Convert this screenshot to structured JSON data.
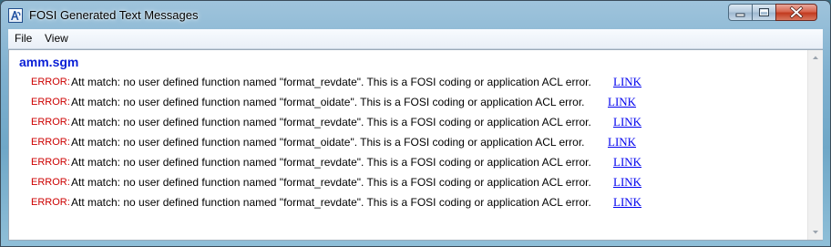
{
  "window": {
    "title": "FOSI Generated Text Messages",
    "accent_color": "#6fa7c7",
    "close_color": "#c23a1f"
  },
  "menu": {
    "items": [
      {
        "label": "File"
      },
      {
        "label": "View"
      }
    ]
  },
  "document": {
    "title": "amm.sgm",
    "title_color": "#0a1fd6",
    "error_color": "#cc0000",
    "link_color": "#0000ee",
    "messages": [
      {
        "level": "ERROR:",
        "text": "Att match: no user defined function named \"format_revdate\". This is a FOSI coding or application ACL error.",
        "link": "LINK"
      },
      {
        "level": "ERROR:",
        "text": "Att match: no user defined function named \"format_oidate\". This is a FOSI coding or application ACL error.",
        "link": "LINK"
      },
      {
        "level": "ERROR:",
        "text": "Att match: no user defined function named \"format_revdate\". This is a FOSI coding or application ACL error.",
        "link": "LINK"
      },
      {
        "level": "ERROR:",
        "text": "Att match: no user defined function named \"format_oidate\". This is a FOSI coding or application ACL error.",
        "link": "LINK"
      },
      {
        "level": "ERROR:",
        "text": "Att match: no user defined function named \"format_revdate\". This is a FOSI coding or application ACL error.",
        "link": "LINK"
      },
      {
        "level": "ERROR:",
        "text": "Att match: no user defined function named \"format_revdate\". This is a FOSI coding or application ACL error.",
        "link": "LINK"
      },
      {
        "level": "ERROR:",
        "text": "Att match: no user defined function named \"format_revdate\". This is a FOSI coding or application ACL error.",
        "link": "LINK"
      }
    ]
  },
  "icons": {
    "app": "fosi-app-icon",
    "minimize": "minimize-icon",
    "maximize": "maximize-icon",
    "close": "close-icon",
    "scroll_up": "arrow-up-icon",
    "scroll_down": "arrow-down-icon"
  }
}
